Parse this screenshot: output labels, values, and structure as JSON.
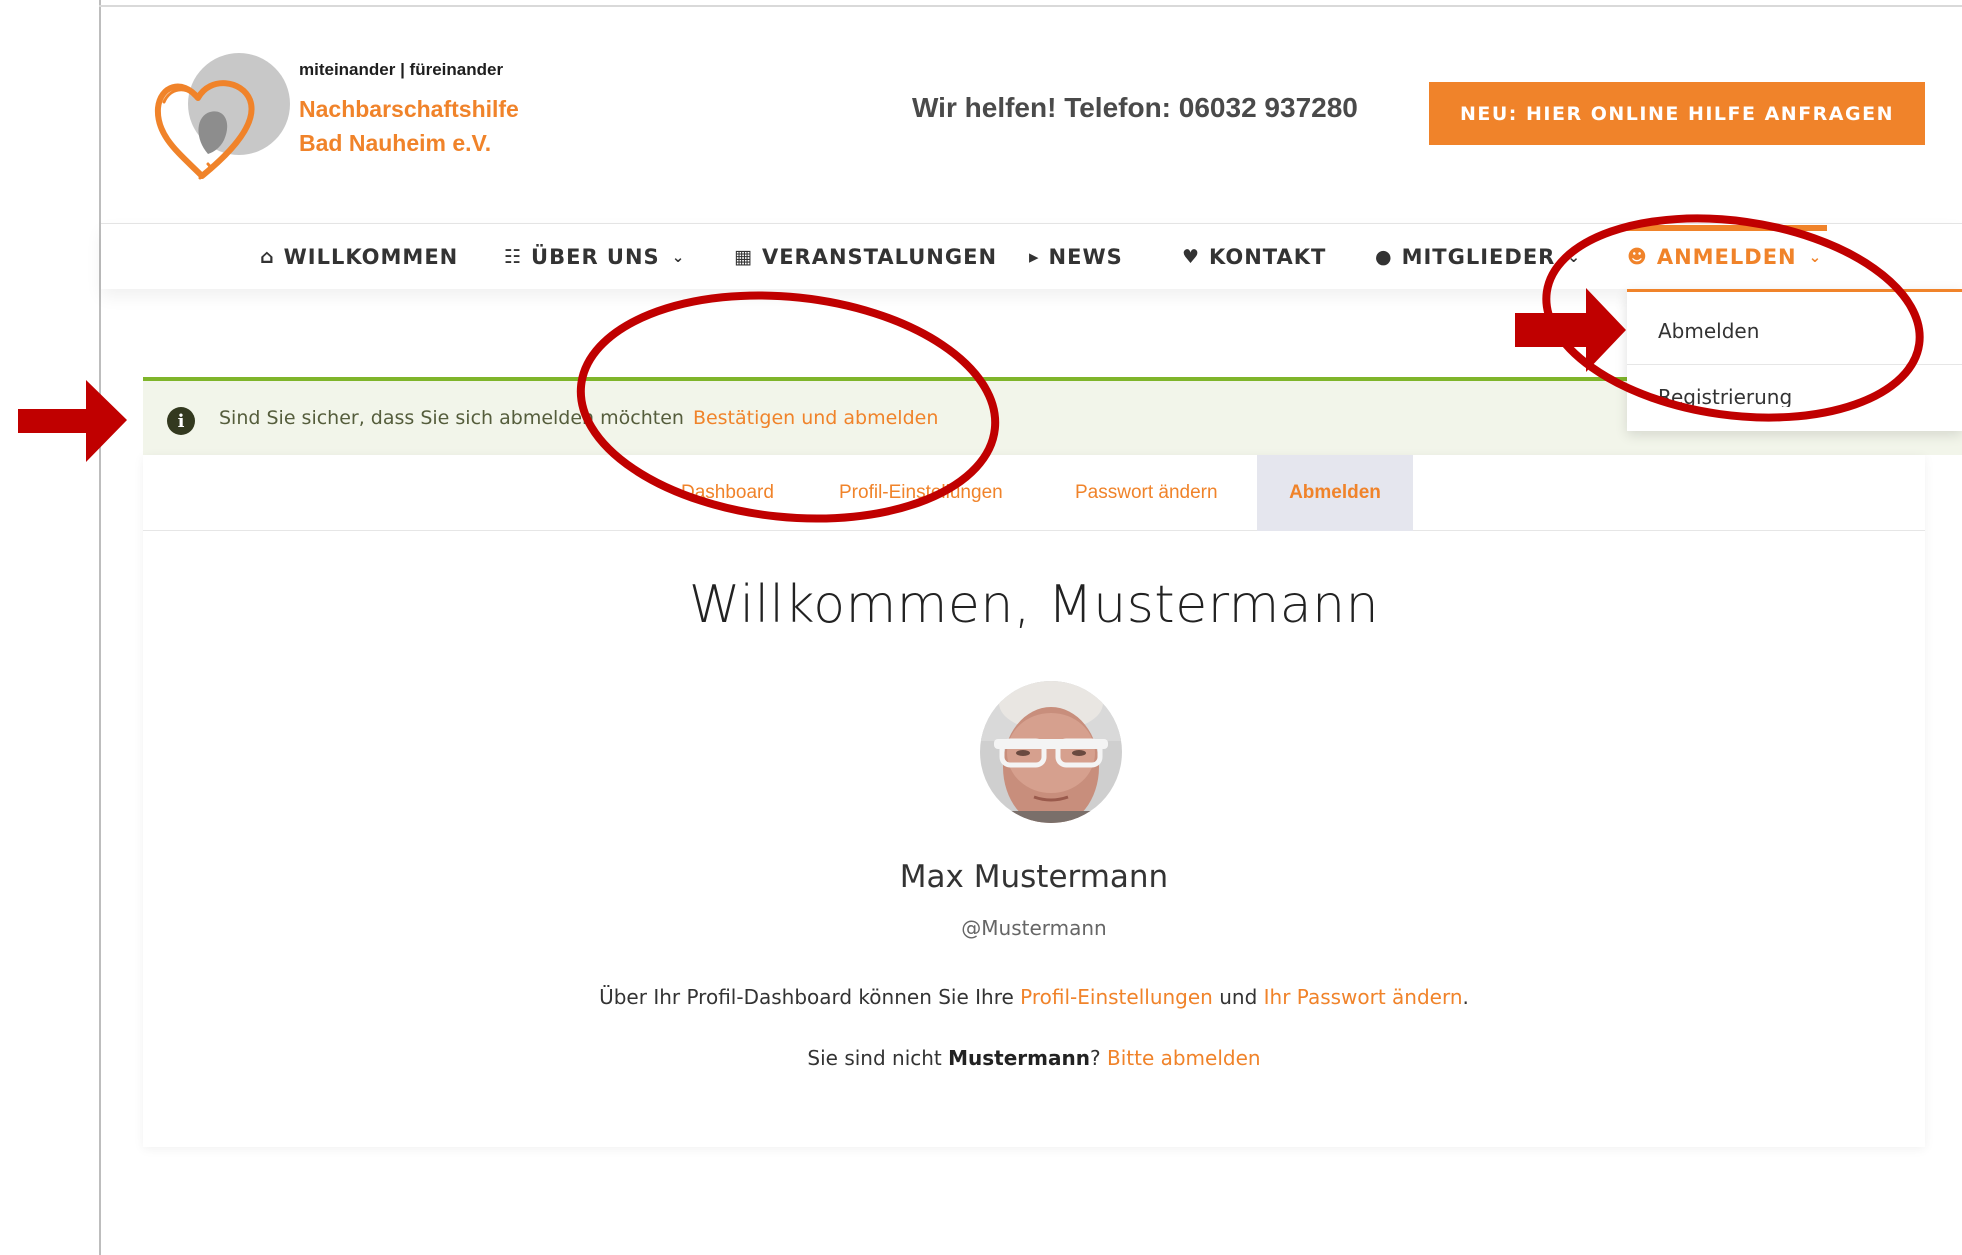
{
  "header": {
    "tagline": "miteinander | füreinander",
    "org_name_line1": "Nachbarschaftshilfe",
    "org_name_line2": "Bad Nauheim e.V.",
    "phone": "Wir helfen! Telefon: 06032 937280",
    "cta_label": "NEU: HIER ONLINE HILFE ANFRAGEN"
  },
  "nav": {
    "items": [
      {
        "label": "WILLKOMMEN",
        "icon": "home-icon"
      },
      {
        "label": "ÜBER UNS",
        "icon": "sitemap-icon"
      },
      {
        "label": "VERANSTALUNGEN",
        "icon": "calendar-icon"
      },
      {
        "label": "NEWS",
        "icon": "megaphone-icon"
      },
      {
        "label": "KONTAKT",
        "icon": "handshake-icon"
      },
      {
        "label": "MITGLIEDER",
        "icon": "users-icon"
      },
      {
        "label": "ANMELDEN",
        "icon": "user-icon"
      }
    ],
    "dropdown": {
      "items": [
        "Abmelden",
        "Registrierung"
      ]
    }
  },
  "notice": {
    "text": "Sind Sie sicher, dass Sie sich abmelden möchten",
    "link": "Bestätigen und abmelden"
  },
  "tabs": [
    "Dashboard",
    "Profil-Einstellungen",
    "Passwort ändern",
    "Abmelden"
  ],
  "profile": {
    "welcome": "Willkommen, Mustermann",
    "full_name": "Max Mustermann",
    "username": "@Mustermann",
    "desc_prefix": "Über Ihr Profil-Dashboard können Sie Ihre",
    "desc_link1": "Profil-Einstellungen",
    "desc_mid": "und",
    "desc_link2": "Ihr Passwort ändern",
    "desc_suffix": ".",
    "not_you_prefix": "Sie sind nicht",
    "not_you_name": "Mustermann",
    "not_you_q": "?",
    "not_you_link": "Bitte abmelden"
  },
  "colors": {
    "accent": "#f0832a",
    "notice_border": "#7fb52a",
    "notice_bg": "#f2f5ea",
    "annotation_red": "#c00000"
  }
}
